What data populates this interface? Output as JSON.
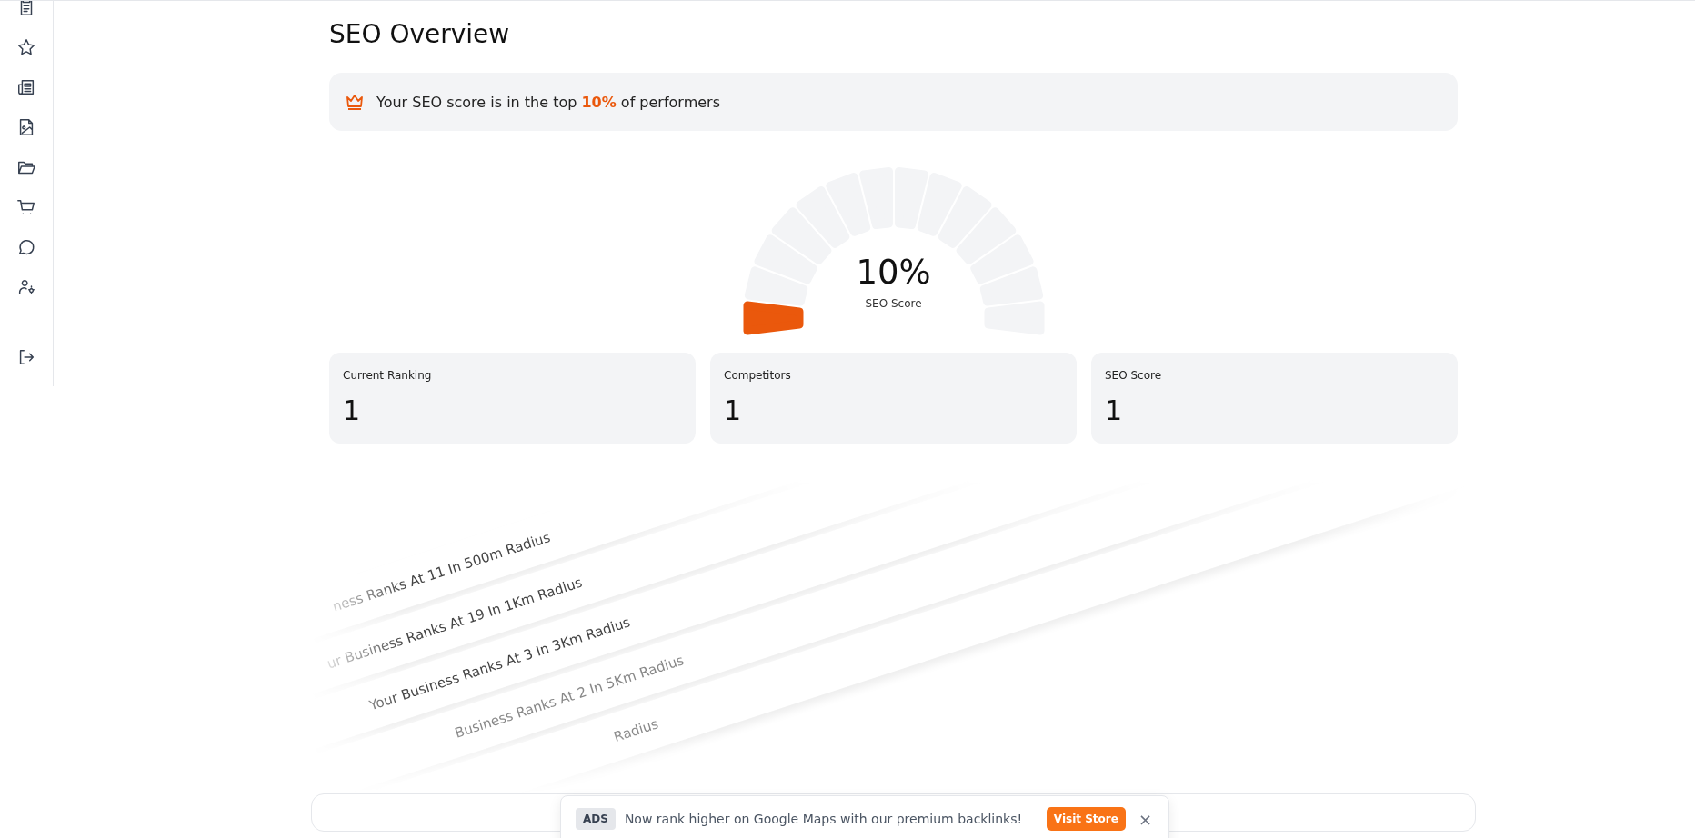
{
  "page": {
    "title": "SEO Overview"
  },
  "banner": {
    "text": "Your SEO score is in the top **10%** of performers"
  },
  "gauge": {
    "level": 0.1,
    "value": "10%",
    "label": "SEO Score"
  },
  "stats": [
    {
      "label": "Current Ranking",
      "value": "1"
    },
    {
      "label": "Competitors",
      "value": "1"
    },
    {
      "label": "SEO Score",
      "value": "1"
    }
  ],
  "rank_strips": [
    {
      "text": "ness Ranks At 11 In 500m Radius"
    },
    {
      "text": "ur Business Ranks At 19 In 1Km Radius"
    },
    {
      "text": "Your Business Ranks At 3 In 3Km Radius"
    },
    {
      "text": "Business Ranks At 2 In 5Km Radius"
    },
    {
      "text": "Radius"
    }
  ],
  "ad": {
    "badge": "ADS",
    "text": "Now rank higher on Google Maps with our premium backlinks!",
    "button": "Visit Store",
    "close": "×"
  }
}
